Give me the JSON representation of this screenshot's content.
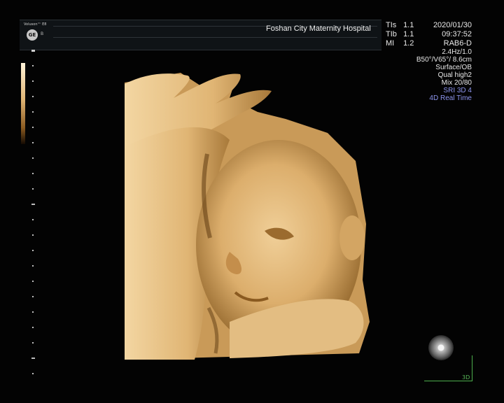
{
  "header": {
    "brand_text": "Voluson™ E8",
    "logo_text": "GE",
    "probe_letter": "B",
    "hospital": "Foshan City Maternity Hospital"
  },
  "indices": [
    {
      "name": "TIs",
      "value": "1.1"
    },
    {
      "name": "TIb",
      "value": "1.1"
    },
    {
      "name": "MI",
      "value": "1.2"
    }
  ],
  "params": {
    "date": "2020/01/30",
    "time": "09:37:52",
    "probe": "RAB6-D",
    "freq": "2.4Hz/1.0",
    "volume": "B50°/V65°/ 8.6cm",
    "mode": "Surface/OB",
    "quality": "Qual high2",
    "mix": "Mix 20/80",
    "sri": "SRI 3D 4",
    "realtime": "4D Real Time"
  },
  "marker_3d": "3D",
  "colors": {
    "background": "#030303",
    "header_bar": "#0f1316",
    "render_skin": "#e3b978",
    "accent_text": "#8d95ee",
    "marker_green": "#4cae4c"
  }
}
